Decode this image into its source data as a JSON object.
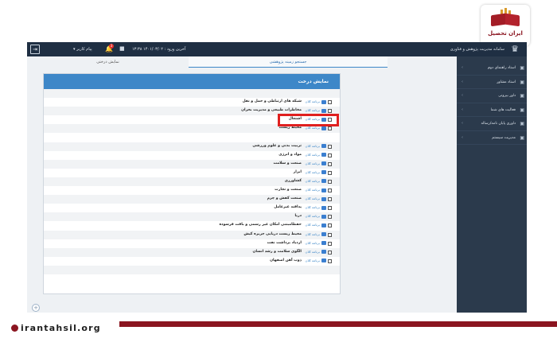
{
  "topbar": {
    "exit_icon": "exit-icon",
    "user_label": "▾ پیام کاربر",
    "notification_count": "3",
    "last_login": "آخرین ورود : ۱۴۰۱/۰۳/۰۲ ۱۳:۳۸",
    "system_title": "سامانه مدیریت پژوهش و فناوری"
  },
  "sidebar": {
    "items": [
      {
        "label": "استاد راهنمای دوم",
        "icon": "user-icon"
      },
      {
        "label": "استاد مشاور",
        "icon": "user-icon"
      },
      {
        "label": "داور بیرونی",
        "icon": "user-icon"
      },
      {
        "label": "فعالیت های شما",
        "icon": "list-icon"
      },
      {
        "label": "داوری پایان نامه/رساله",
        "icon": "doc-icon"
      },
      {
        "label": "مدیریت سیستم",
        "icon": "gear-icon"
      }
    ]
  },
  "tabs": {
    "active": "جستجو زمینه پژوهشی",
    "other": "نمایش درختی"
  },
  "panel": {
    "title": "نمایش درخت",
    "rows": [
      {
        "name": "",
        "prog": ""
      },
      {
        "name": "شبکه های ارتباطی و حمل و نقل",
        "prog": "برنامه کلان"
      },
      {
        "name": "مخاطرات طبیعی و مدیریت بحران",
        "prog": "برنامه کلان"
      },
      {
        "name": "اشتغال",
        "prog": "برنامه کلان"
      },
      {
        "name": "محیط زیست",
        "prog": "برنامه کلان"
      },
      {
        "name": "",
        "prog": ""
      },
      {
        "name": "تربیت بدنی و علوم ورزشی",
        "prog": "برنامه کلان"
      },
      {
        "name": "مواد و انرژی",
        "prog": "برنامه کلان"
      },
      {
        "name": "صنعت و سلامت",
        "prog": "برنامه کلان"
      },
      {
        "name": "ابزار",
        "prog": "برنامه کلان"
      },
      {
        "name": "کشاورزی",
        "prog": "برنامه کلان"
      },
      {
        "name": "صنعت و تجارت",
        "prog": "برنامه کلان"
      },
      {
        "name": "صنعت کفش و چرم",
        "prog": "برنامه کلان"
      },
      {
        "name": "پدافند غیرعامل",
        "prog": "برنامه کلان"
      },
      {
        "name": "دریا",
        "prog": "برنامه کلان"
      },
      {
        "name": "حفظامبتنی امکان غیر رسمی و بافت فرسوده",
        "prog": "برنامه کلان"
      },
      {
        "name": "محیط زیست دریایی جزیره کیش",
        "prog": "برنامه کلان"
      },
      {
        "name": "ازدیاد برداشت نفت",
        "prog": "برنامه کلان"
      },
      {
        "name": "الگوی سلامت و رشد انسان",
        "prog": "برنامه کلان"
      },
      {
        "name": "ذوب آهن اصفهان",
        "prog": "برنامه کلان"
      },
      {
        "name": "",
        "prog": ""
      },
      {
        "name": "",
        "prog": ""
      }
    ]
  },
  "branding": {
    "logo_text": "ایران تحصیل",
    "site": "irantahsil.org"
  },
  "colors": {
    "accent": "#3d87c8",
    "sidebar": "#2b3a4c",
    "topbar": "#1f2f43",
    "highlight": "#e0201f",
    "brand": "#8b1520"
  }
}
